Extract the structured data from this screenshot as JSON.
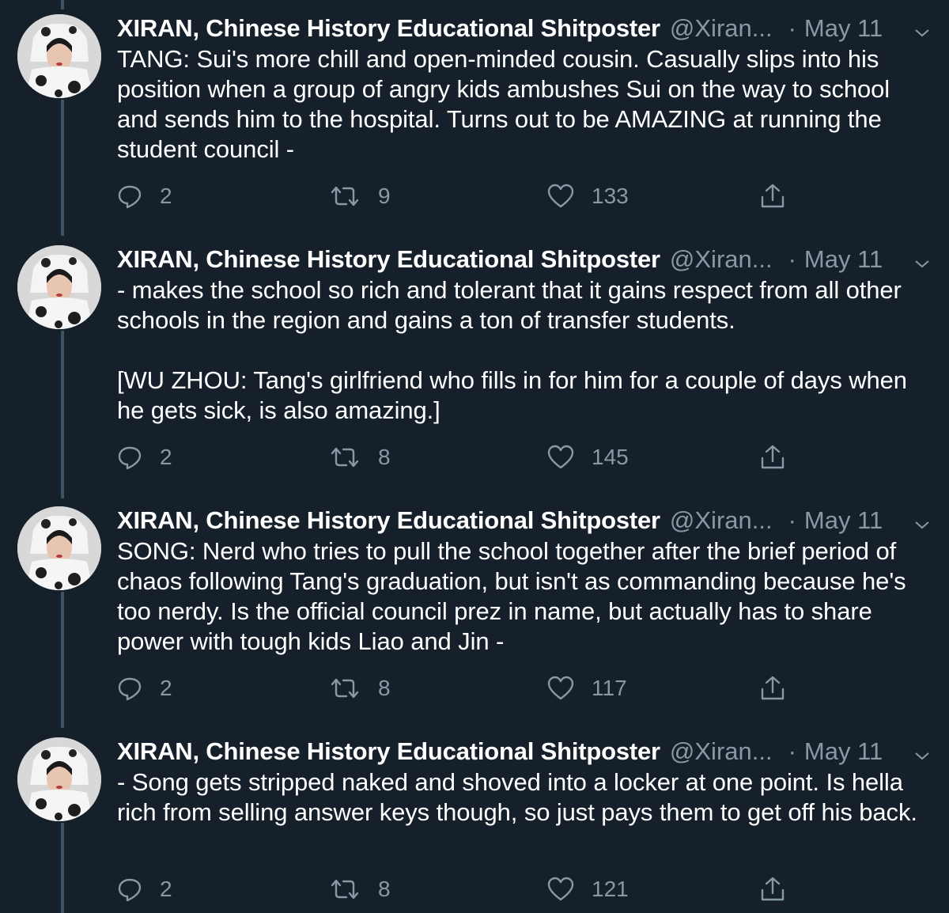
{
  "colors": {
    "background": "#15202b",
    "text_primary": "#ffffff",
    "text_secondary": "#8899a6",
    "thread_line": "#3d5466"
  },
  "icons": {
    "reply": "speech-bubble-icon",
    "retweet": "retweet-arrows-icon",
    "like": "heart-icon",
    "share": "share-upload-icon",
    "more": "chevron-down-icon"
  },
  "tweets": [
    {
      "display_name": "XIRAN, Chinese History Educational Shitposter",
      "handle": "@Xiran...",
      "separator": "·",
      "date": "May 11",
      "text": "TANG: Sui's more chill and open-minded cousin. Casually slips into his position when a group of angry kids ambushes Sui on the way to school and sends him to the hospital. Turns out to be AMAZING at running the student council -",
      "replies": "2",
      "retweets": "9",
      "likes": "133"
    },
    {
      "display_name": "XIRAN, Chinese History Educational Shitposter",
      "handle": "@Xiran...",
      "separator": "·",
      "date": "May 11",
      "text": "- makes the school so rich and tolerant that it gains respect from all other schools in the region and gains a ton of transfer students.\n\n[WU ZHOU: Tang's girlfriend who fills in for him for a couple of days when he gets sick, is also amazing.]",
      "replies": "2",
      "retweets": "8",
      "likes": "145"
    },
    {
      "display_name": "XIRAN, Chinese History Educational Shitposter",
      "handle": "@Xiran...",
      "separator": "·",
      "date": "May 11",
      "text": "SONG: Nerd who tries to pull the school together after the brief period of chaos following Tang's graduation, but isn't as commanding because he's too nerdy. Is the official council prez in name, but actually has to share power with tough kids Liao and Jin -",
      "replies": "2",
      "retweets": "8",
      "likes": "117"
    },
    {
      "display_name": "XIRAN, Chinese History Educational Shitposter",
      "handle": "@Xiran...",
      "separator": "·",
      "date": "May 11",
      "text": "- Song gets stripped naked and shoved into a locker at one point. Is hella rich from selling answer keys though, so just pays them to get off his back.",
      "replies": "2",
      "retweets": "8",
      "likes": "121"
    }
  ]
}
